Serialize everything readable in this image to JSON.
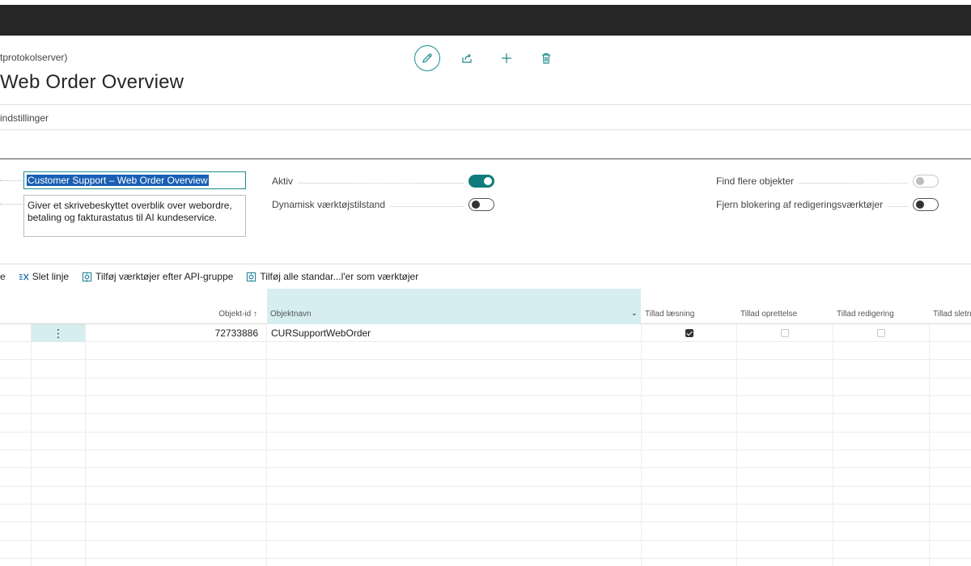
{
  "header": {
    "breadcrumb": "tprotokolserver)",
    "title": "Web Order Overview"
  },
  "tabs": {
    "settings": "indstillinger"
  },
  "general": {
    "name_value": "Customer Support – Web Order Overview",
    "description": "Giver et skrivebeskyttet overblik over webordre, betaling og fakturastatus til AI kundeservice.",
    "toggles": [
      {
        "label": "Aktiv",
        "state": "on"
      },
      {
        "label": "Dynamisk værktøjstilstand",
        "state": "off"
      },
      {
        "label": "Find flere objekter",
        "state": "disabled"
      },
      {
        "label": "Fjern blokering af redigeringsværktøjer",
        "state": "off"
      }
    ]
  },
  "lines_actions": {
    "partial": "e",
    "delete_line": "Slet linje",
    "add_by_api_group": "Tilføj værktøjer efter API-gruppe",
    "add_all_standard": "Tilføj alle standar...l'er som værktøjer"
  },
  "grid": {
    "columns": {
      "object_id": "Objekt-id",
      "object_id_sort": "↑",
      "object_name": "Objektnavn",
      "allow_read": "Tillad læsning",
      "allow_create": "Tillad oprettelse",
      "allow_modify": "Tillad redigering",
      "allow_delete": "Tillad sletni"
    },
    "rows": [
      {
        "menu": "⋮",
        "object_id": "72733886",
        "object_name": "CURSupportWebOrder",
        "read": true,
        "create": false,
        "modify": false
      }
    ]
  },
  "icons": [
    "pencil-icon",
    "share-icon",
    "plus-icon",
    "trash-icon",
    "delete-line-icon",
    "api-group-icon",
    "add-all-icon",
    "chevron-down-icon"
  ],
  "colors": {
    "accent": "#0f7b7b",
    "selected_column": "#d6eef0",
    "topbar": "#262626"
  }
}
